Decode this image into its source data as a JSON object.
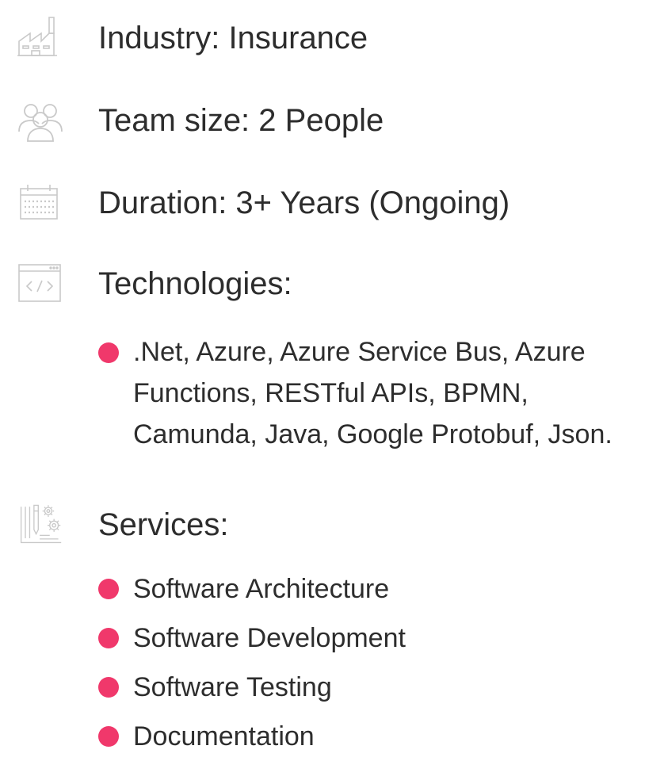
{
  "colors": {
    "accent": "#f0386b",
    "icon_stroke": "#c9c9c9",
    "text": "#2d2d2d"
  },
  "rows": {
    "industry": {
      "icon": "factory-icon",
      "label": "Industry: Insurance"
    },
    "team": {
      "icon": "team-people-icon",
      "label": "Team size: 2 People"
    },
    "duration": {
      "icon": "calendar-icon",
      "label": "Duration: 3+ Years (Ongoing)"
    },
    "technologies": {
      "icon": "code-window-icon",
      "label": "Technologies:"
    },
    "services": {
      "icon": "blueprint-gears-icon",
      "label": "Services:"
    }
  },
  "technologies_list": [
    ".Net, Azure, Azure Service Bus, Azure Functions, RESTful APIs, BPMN, Camunda, Java, Google Protobuf, Json."
  ],
  "services_list": [
    "Software Architecture",
    "Software Development",
    "Software Testing",
    "Documentation"
  ]
}
